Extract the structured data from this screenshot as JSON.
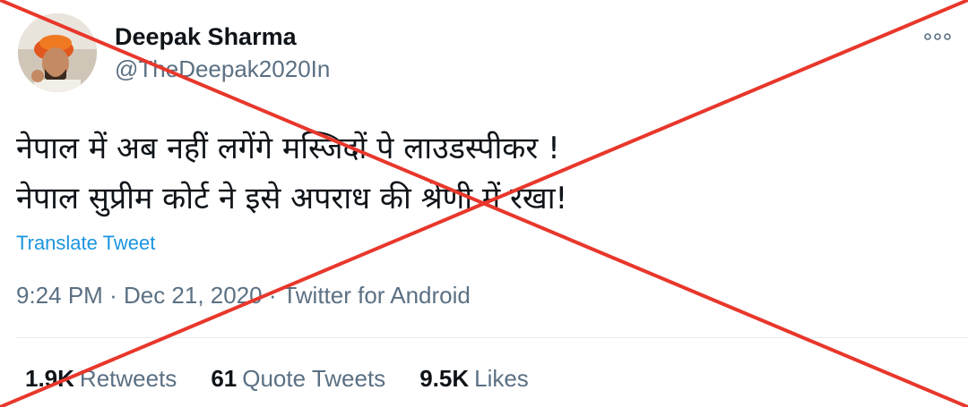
{
  "author": {
    "name": "Deepak Sharma",
    "handle": "@TheDeepak2020In"
  },
  "tweet": {
    "lines": [
      "नेपाल में अब नहीं लगेंगे मस्जिदों पे लाउडस्पीकर !",
      "नेपाल सुप्रीम कोर्ट ने इसे अपराध की श्रेणी में रखा!"
    ],
    "translate_label": "Translate Tweet",
    "time": "9:24 PM",
    "date": "Dec 21, 2020",
    "source": "Twitter for Android",
    "separator": "·"
  },
  "stats": {
    "retweets_count": "1.9K",
    "retweets_label": "Retweets",
    "quotes_count": "61",
    "quotes_label": "Quote Tweets",
    "likes_count": "9.5K",
    "likes_label": "Likes"
  },
  "icons": {
    "more": "more-options-icon",
    "overlay": "red-cross-overlay"
  },
  "colors": {
    "cross": "#e8372c",
    "link": "#1b95e0",
    "secondary": "#5b7083",
    "primary": "#0f1419"
  }
}
